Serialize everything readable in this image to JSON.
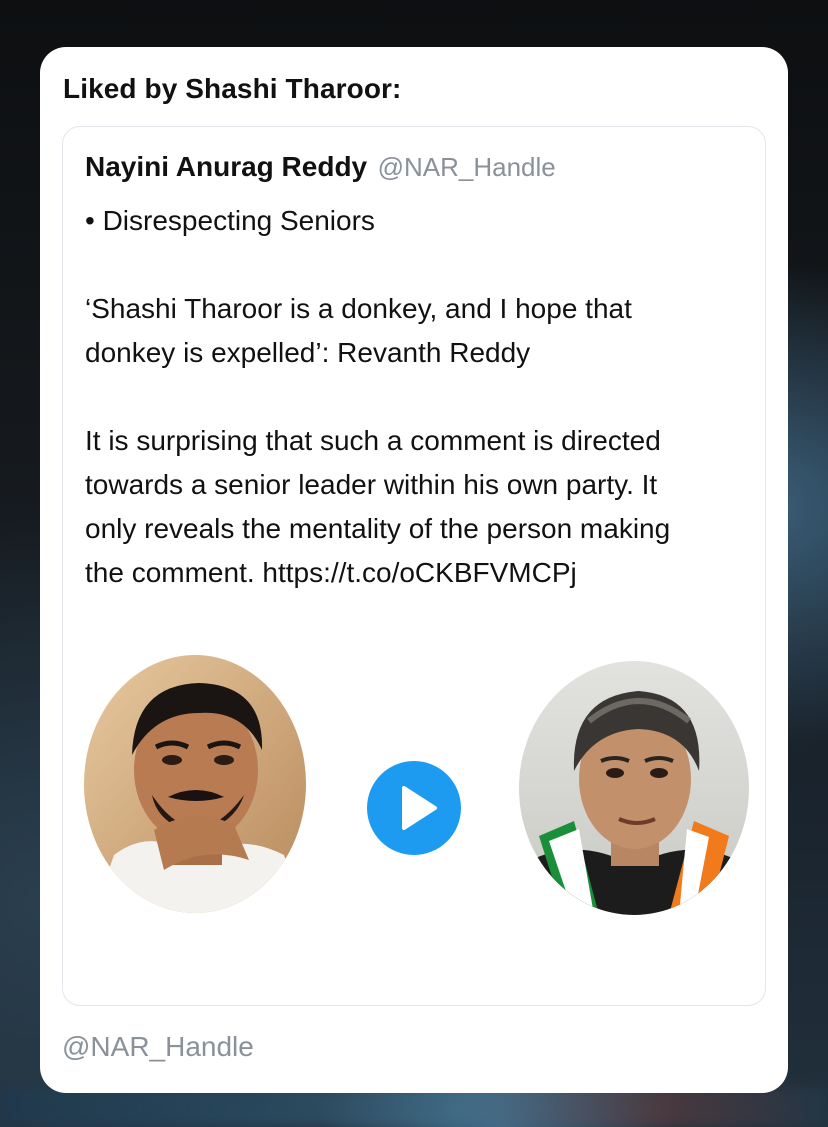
{
  "header": {
    "title": "Liked by Shashi Tharoor:"
  },
  "tweet": {
    "author_name": "Nayini Anurag Reddy",
    "author_handle": "@NAR_Handle",
    "paragraphs": [
      [
        "• Disrespecting Seniors"
      ],
      [
        "‘Shashi Tharoor is a donkey, and I hope that",
        "donkey is expelled’: Revanth Reddy"
      ],
      [
        "It is surprising that such a comment is directed",
        "towards a senior leader within his own party. It",
        "only reveals the mentality of the person making",
        "the comment. https://t.co/oCKBFVMCPj"
      ]
    ],
    "media": {
      "left_photo": "person-photo-left",
      "right_photo": "person-photo-right",
      "play_icon": "play-icon",
      "accent_color": "#1d9bf0"
    }
  },
  "footer": {
    "handle": "@NAR_Handle"
  }
}
